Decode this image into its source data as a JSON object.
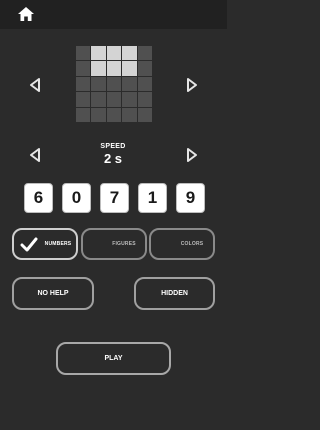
{
  "header": {
    "home_icon": "home-icon"
  },
  "pattern": {
    "rows": 5,
    "cols": 5,
    "on_cells": [
      1,
      2,
      3,
      6,
      7,
      8
    ]
  },
  "speed": {
    "label": "SPEED",
    "value": "2 s"
  },
  "digits": [
    "6",
    "0",
    "7",
    "1",
    "9"
  ],
  "modes": [
    {
      "label": "NUMBERS",
      "selected": true
    },
    {
      "label": "FIGURES",
      "selected": false
    },
    {
      "label": "COLORS",
      "selected": false
    }
  ],
  "help_button": "NO HELP",
  "hidden_button": "HIDDEN",
  "play_button": "PLAY",
  "colors": {
    "background": "#2b2b2b",
    "topbar": "#212121",
    "cell_off": "#505050",
    "cell_on": "#d4d4d4"
  }
}
